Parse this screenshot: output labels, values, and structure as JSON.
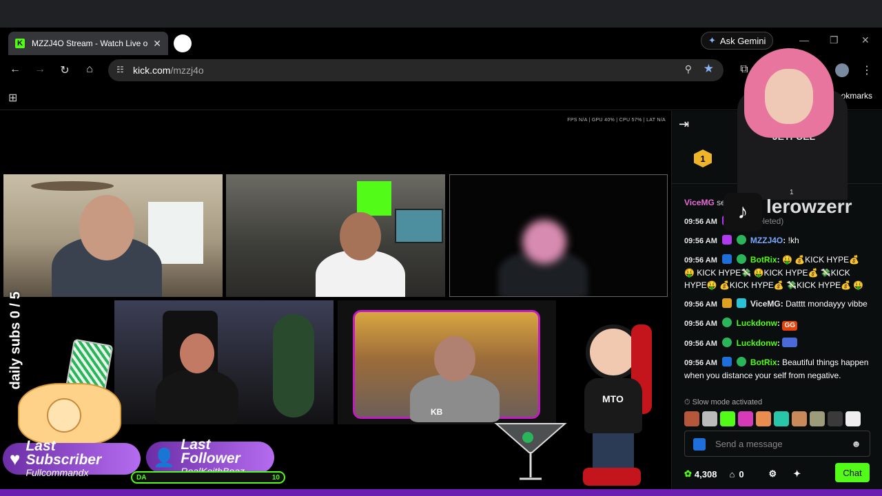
{
  "browser": {
    "tab_title": "MZZJ4O Stream - Watch Live o",
    "tab_close": "✕",
    "gemini_label": "Ask Gemini",
    "url_domain": "kick.com",
    "url_path": "/mzzj4o",
    "all_bookmarks": "All Bookmarks"
  },
  "stream": {
    "stats": "FPS N/A  |  GPU 40%  |  CPU 57%  |  LAT N/A",
    "daily_subs": "daily subs 0 / 5",
    "last_subscriber_label": "Last Subscriber",
    "last_subscriber_name": "Fullcommandx",
    "last_follower_label": "Last Follower",
    "last_follower_name": "RealKeithBoaz",
    "goal_left": "DA",
    "goal_right": "10",
    "mascot_shirt": "MTO",
    "cam5_logo": "KB"
  },
  "webcam_overlay": {
    "tiktok_name": "lerowzerr",
    "tiktok_count": "1"
  },
  "chat": {
    "pinned_user": "ViceMG",
    "pinned_suffix": "se",
    "pinned_rank": "1",
    "messages": [
      {
        "time": "09:56 AM",
        "user": "",
        "text": "!kh (Deleted)"
      },
      {
        "time": "09:56 AM",
        "user": "MZZJ4O",
        "text": "!kh"
      },
      {
        "time": "09:56 AM",
        "user": "BotRix",
        "text": "🤑 💰KICK HYPE💰 🤑 KICK HYPE💸 🤑KICK HYPE💰 💸KICK HYPE🤑 💰KICK HYPE💰 💸KICK HYPE💰 🤑"
      },
      {
        "time": "09:56 AM",
        "user": "ViceMG",
        "text": "Datttt mondayyy vibbe"
      },
      {
        "time": "09:56 AM",
        "user": "Luckdonw",
        "text": "GG"
      },
      {
        "time": "09:56 AM",
        "user": "Luckdonw",
        "text": ""
      },
      {
        "time": "09:56 AM",
        "user": "BotRix",
        "text": "Beautiful things happen when you distance your self from negative."
      }
    ],
    "slow_mode": "Slow mode activated",
    "input_placeholder": "Send a message",
    "points": "4,308",
    "stores": "0",
    "chat_button": "Chat"
  },
  "colors": {
    "kick_green": "#53fc18",
    "purple": "#6a1fb0"
  }
}
